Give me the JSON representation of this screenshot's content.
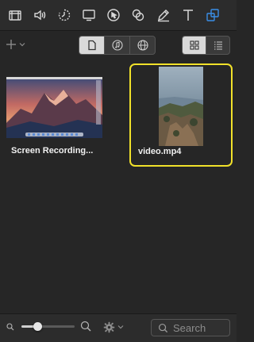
{
  "toolbar": {
    "icons": [
      "clapperboard-icon",
      "speaker-icon",
      "timer-icon",
      "screen-icon",
      "cursor-icon",
      "overlap-circles-icon",
      "pen-icon",
      "text-icon",
      "duplicate-icon"
    ],
    "active_icon": "duplicate-icon",
    "accent_color": "#3a8ee6"
  },
  "subbar": {
    "add_icon": "plus-icon",
    "media_filters": [
      "document-icon",
      "music-icon",
      "globe-icon"
    ],
    "selected_filter": "document-icon",
    "views": [
      "grid-icon",
      "list-icon"
    ],
    "selected_view": "grid-icon"
  },
  "media": {
    "items": [
      {
        "label": "Screen Recording...",
        "selected": false
      },
      {
        "label": "video.mp4",
        "selected": true
      }
    ],
    "selection_color": "#f1e12a"
  },
  "bottombar": {
    "zoom_level": 0.3,
    "search_placeholder": "Search"
  }
}
